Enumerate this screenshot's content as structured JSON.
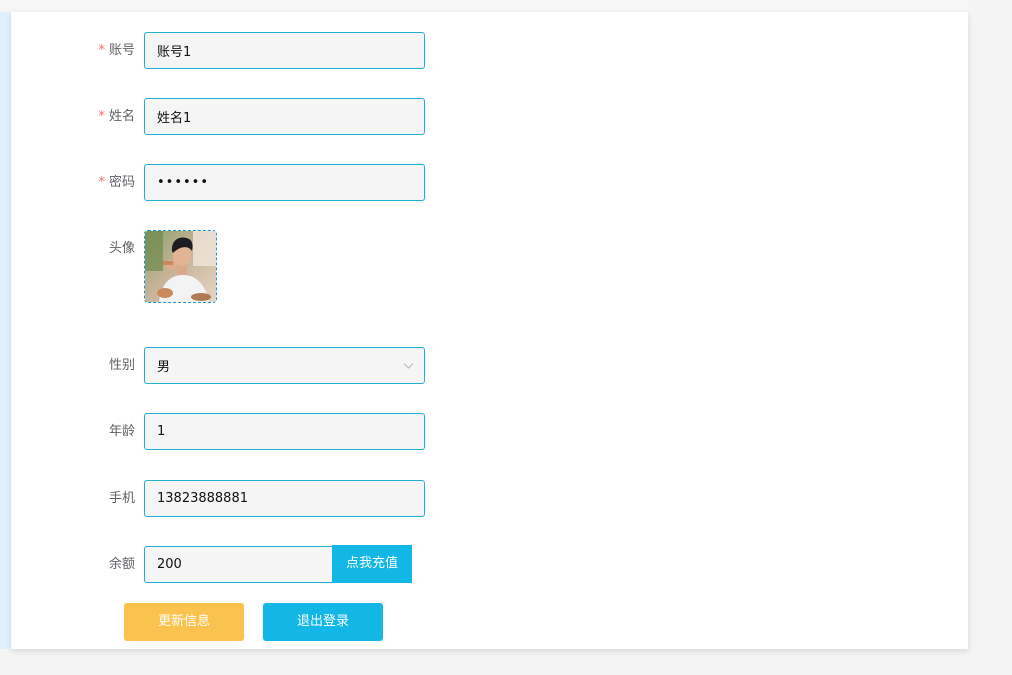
{
  "form": {
    "account": {
      "label": "账号",
      "required": true,
      "value": "账号1"
    },
    "name": {
      "label": "姓名",
      "required": true,
      "value": "姓名1"
    },
    "password": {
      "label": "密码",
      "required": true,
      "masked": "••••••"
    },
    "avatar": {
      "label": "头像"
    },
    "gender": {
      "label": "性别",
      "value": "男"
    },
    "age": {
      "label": "年龄",
      "value": "1"
    },
    "phone": {
      "label": "手机",
      "value": "13823888881"
    },
    "balance": {
      "label": "余额",
      "value": "200",
      "recharge_label": "点我充值"
    }
  },
  "actions": {
    "update_label": "更新信息",
    "logout_label": "退出登录"
  },
  "colors": {
    "accent": "#12b7e6",
    "update": "#fbc34e",
    "required": "#f56c6c"
  }
}
